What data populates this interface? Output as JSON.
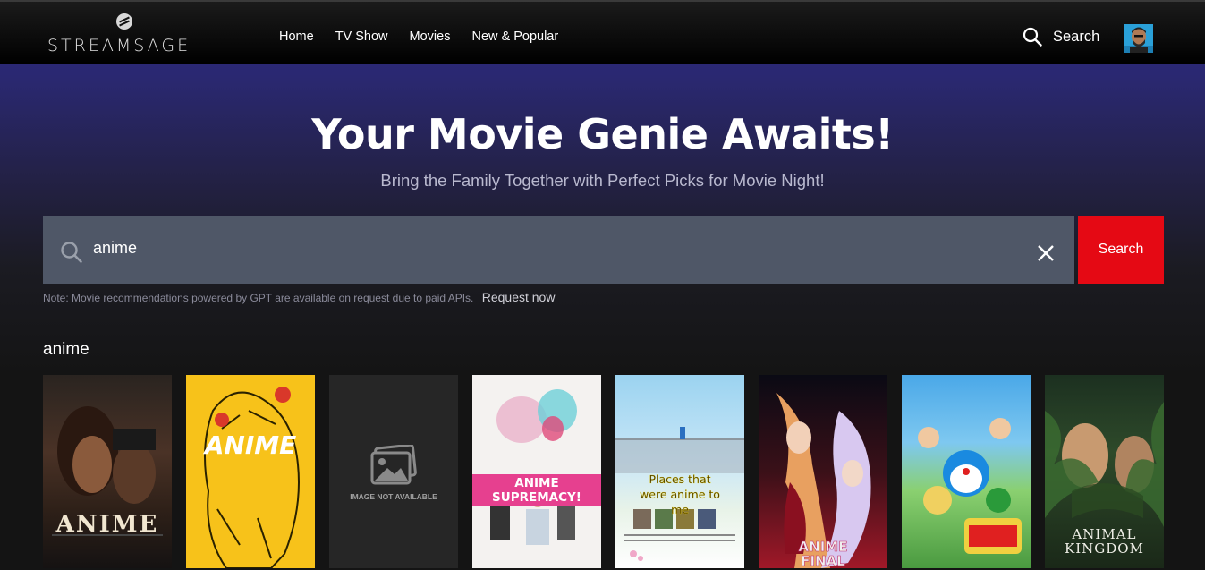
{
  "brand": {
    "name": "STREAMSAGE"
  },
  "nav": {
    "items": [
      {
        "label": "Home"
      },
      {
        "label": "TV Show"
      },
      {
        "label": "Movies"
      },
      {
        "label": "New & Popular"
      }
    ],
    "search_label": "Search"
  },
  "hero": {
    "title": "Your Movie Genie Awaits!",
    "subtitle": "Bring the Family Together with Perfect Picks for Movie Night!"
  },
  "search": {
    "value": "anime",
    "button_label": "Search",
    "note": "Note: Movie recommendations powered by GPT are available on request due to paid APIs.",
    "request_link": "Request now"
  },
  "results": {
    "title": "anime",
    "posters": [
      {
        "title": "ANIME"
      },
      {
        "title": "ANIME"
      },
      {
        "title": "IMAGE NOT AVAILABLE"
      },
      {
        "title": "ANIME SUPREMACY!"
      },
      {
        "title": "Places that were anime to me"
      },
      {
        "title": "ANIME FINAL"
      },
      {
        "title": ""
      },
      {
        "title": "ANIMAL KINGDOM"
      }
    ]
  },
  "colors": {
    "accent": "#e50914",
    "searchbox": "#4f5767",
    "background": "#141414"
  }
}
